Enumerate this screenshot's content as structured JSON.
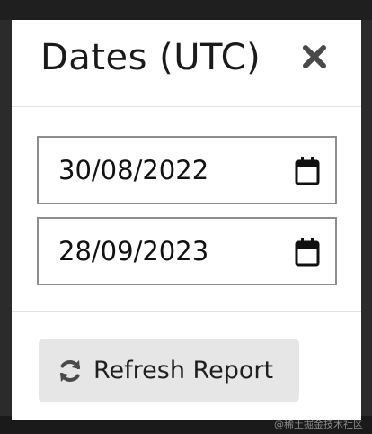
{
  "modal": {
    "title": "Dates (UTC)",
    "close_icon": "close-x-icon"
  },
  "date_range": {
    "start_date": "30/08/2022",
    "end_date": "28/09/2023",
    "calendar_icon": "calendar-icon"
  },
  "actions": {
    "refresh_label": "Refresh Report",
    "refresh_icon": "refresh-sync-icon"
  },
  "watermark": "@稀土掘金技术社区",
  "colors": {
    "backdrop": "#2b2b2b",
    "modal_bg": "#ffffff",
    "field_border": "#8d8d8d",
    "button_bg": "#e6e6e6",
    "icon": "#4a4a4a",
    "text": "#1a1a1a"
  }
}
